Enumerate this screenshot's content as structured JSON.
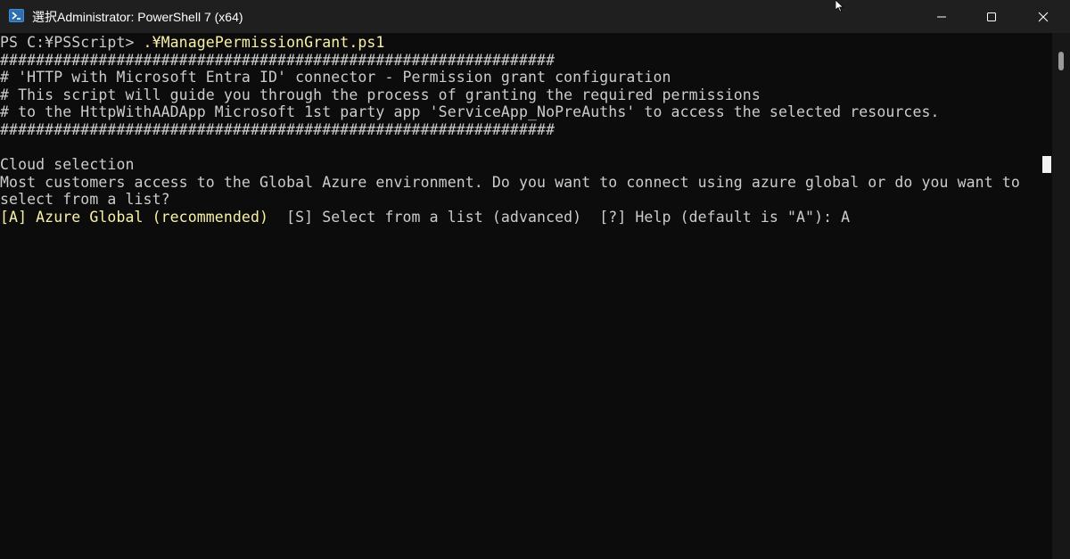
{
  "window": {
    "title": "選択Administrator: PowerShell 7 (x64)",
    "controls": {
      "minimize": "minimize",
      "maximize": "maximize",
      "close": "close"
    }
  },
  "console": {
    "prompt": "PS C:¥PSScript> ",
    "command": ".¥ManagePermissionGrant.ps1",
    "hash_line": "##############################################################",
    "comment_1": "# 'HTTP with Microsoft Entra ID' connector - Permission grant configuration",
    "comment_2": "# This script will guide you through the process of granting the required permissions",
    "comment_3": "# to the HttpWithAADApp Microsoft 1st party app 'ServiceApp_NoPreAuths' to access the selected resources.",
    "hash_line_2": "##############################################################",
    "section_title": "Cloud selection",
    "question_1": "Most customers access to the Global Azure environment. Do you want to connect using azure global or do you want to",
    "question_2": "select from a list?",
    "choice_a": "[A] Azure Global (recommended)",
    "choice_rest": "  [S] Select from a list (advanced)  [?] Help (default is \"A\"): A"
  }
}
